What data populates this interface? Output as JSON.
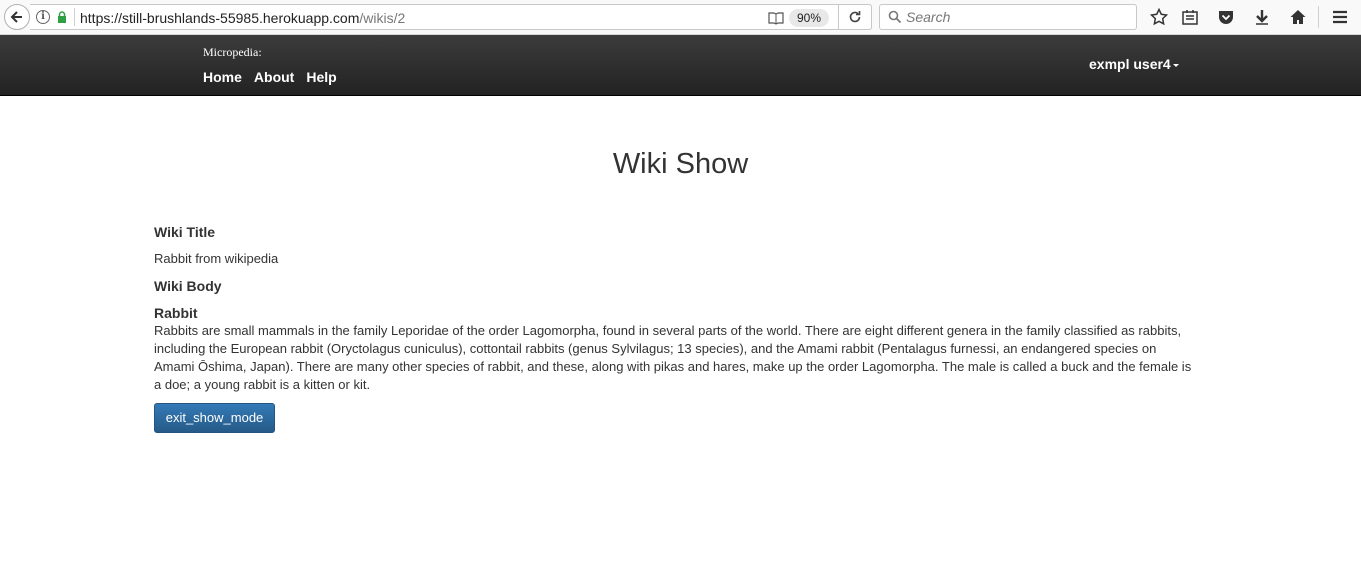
{
  "browser": {
    "url_host": "https://still-brushlands-55985.herokuapp.com",
    "url_path": "/wikis/2",
    "zoom": "90%",
    "search_placeholder": "Search"
  },
  "navbar": {
    "brand": "Micropedia:",
    "links": [
      "Home",
      "About",
      "Help"
    ],
    "user": "exmpl user4"
  },
  "page": {
    "title": "Wiki Show",
    "wiki_title_label": "Wiki Title",
    "wiki_title_value": "Rabbit from wikipedia",
    "wiki_body_label": "Wiki Body",
    "body_heading": "Rabbit",
    "body_text": "Rabbits are small mammals in the family Leporidae of the order Lagomorpha, found in several parts of the world. There are eight different genera in the family classified as rabbits, including the European rabbit (Oryctolagus cuniculus), cottontail rabbits (genus Sylvilagus; 13 species), and the Amami rabbit (Pentalagus furnessi, an endangered species on Amami Ōshima, Japan). There are many other species of rabbit, and these, along with pikas and hares, make up the order Lagomorpha. The male is called a buck and the female is a doe; a young rabbit is a kitten or kit.",
    "exit_button": "exit_show_mode"
  },
  "colors": {
    "navbar_bg": "#222222",
    "button_bg": "#337ab7",
    "lock_green": "#2ea043"
  }
}
